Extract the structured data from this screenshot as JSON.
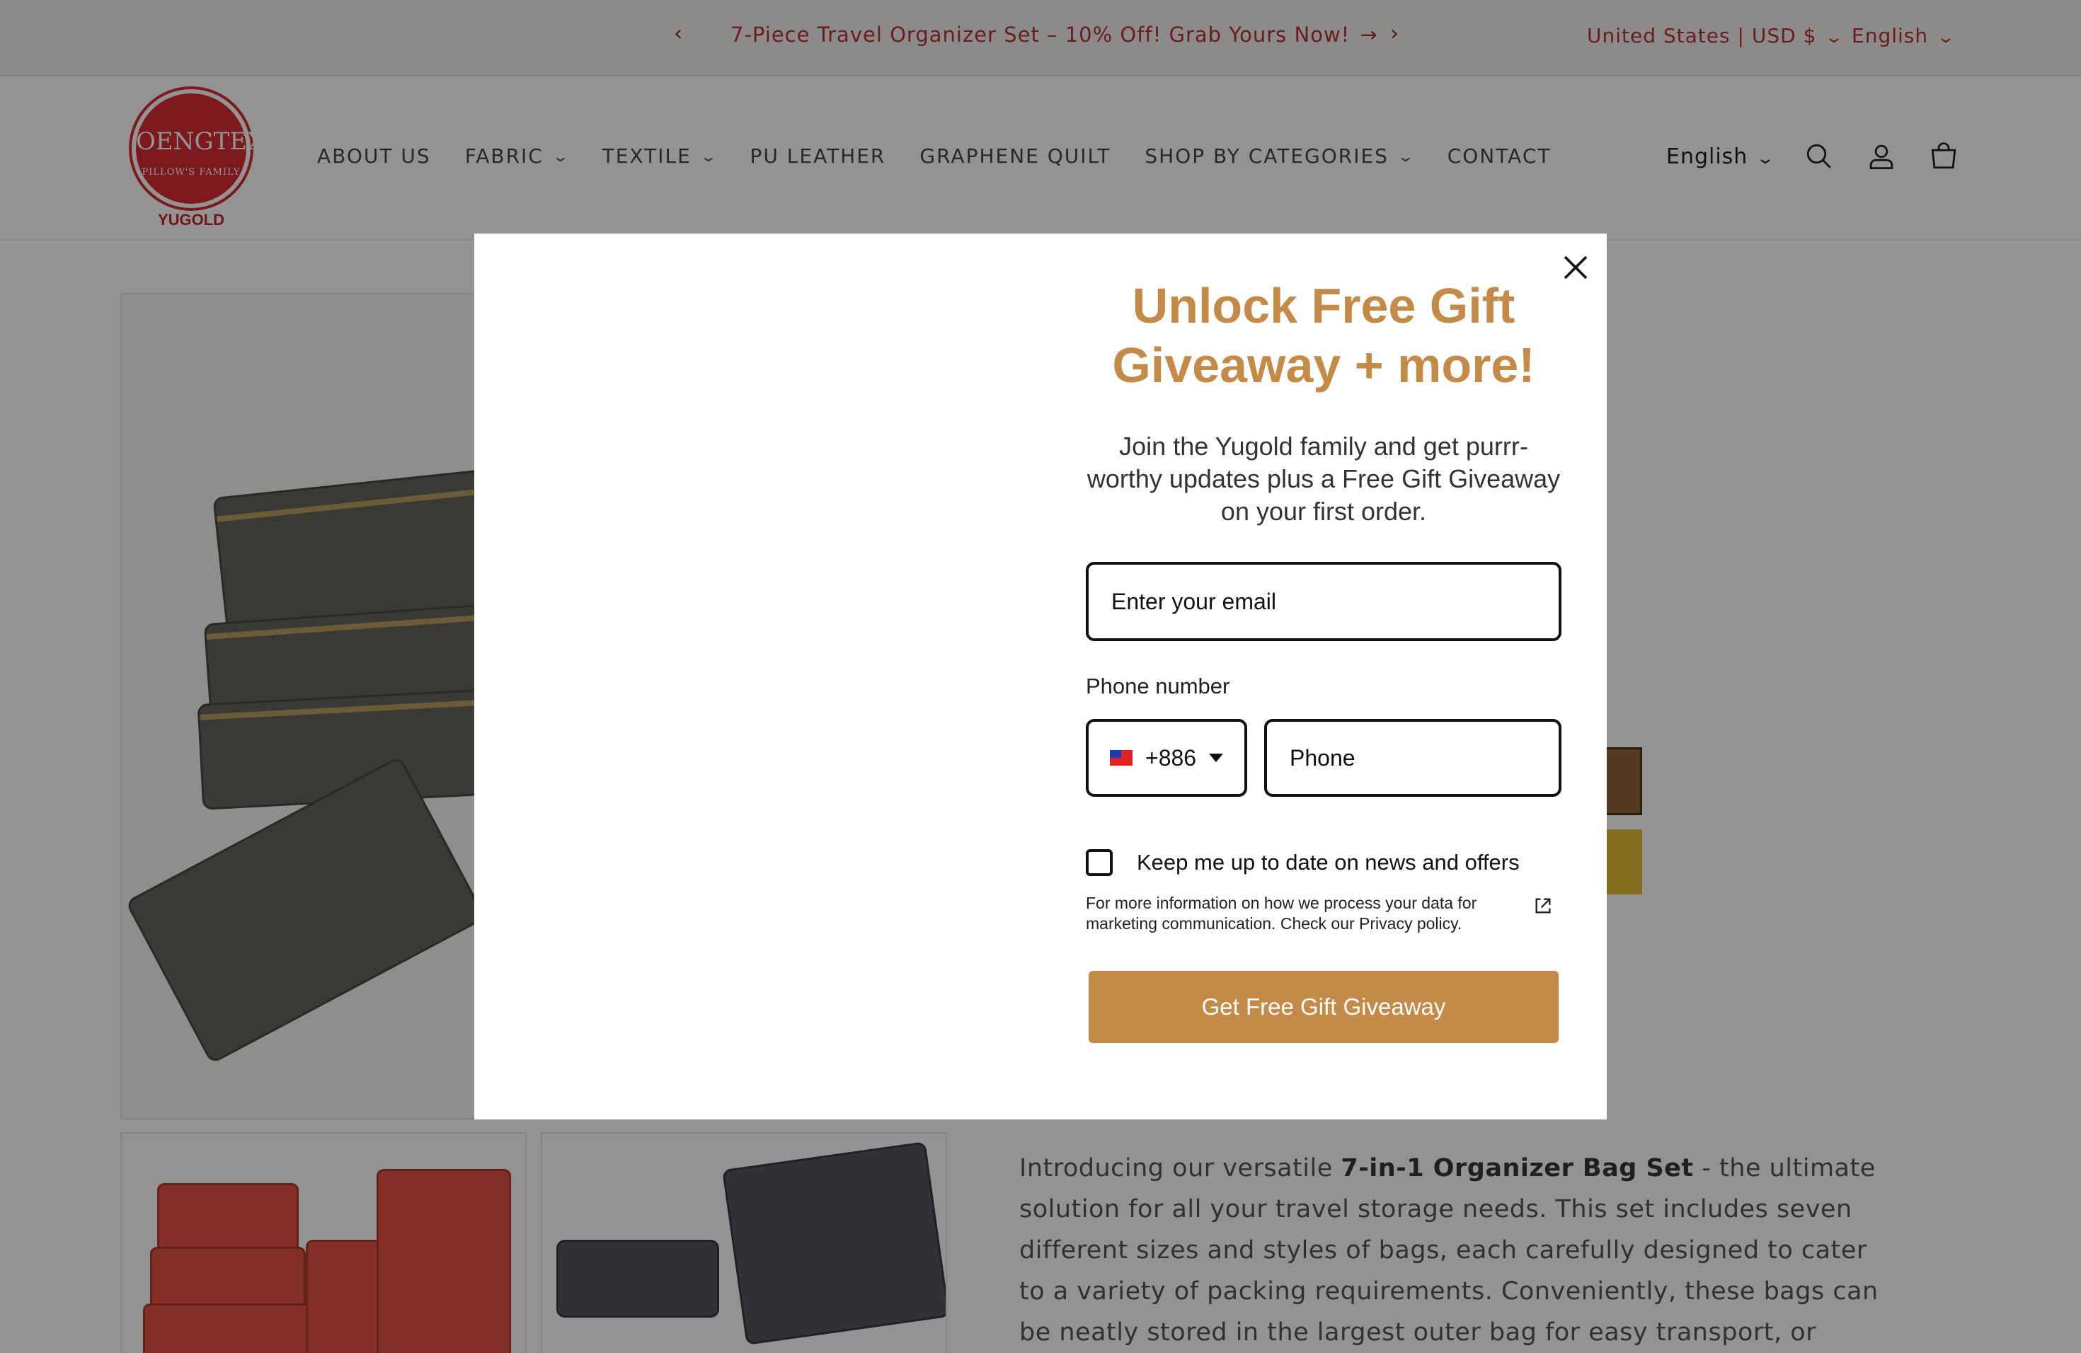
{
  "announcement": {
    "prev_icon": "chevron-left",
    "message": "7-Piece Travel Organizer Set – 10% Off! Grab Yours Now!",
    "message_icon": "arrow-right",
    "next_icon": "chevron-right",
    "locale": "United States | USD $",
    "language": "English"
  },
  "header": {
    "logo": {
      "mark": "OENGTEX",
      "tagline": "PILLOW'S FAMILY",
      "brand": "YUGOLD"
    },
    "nav": [
      {
        "label": "ABOUT US",
        "dropdown": false
      },
      {
        "label": "FABRIC",
        "dropdown": true
      },
      {
        "label": "TEXTILE",
        "dropdown": true
      },
      {
        "label": "PU LEATHER",
        "dropdown": false
      },
      {
        "label": "GRAPHENE QUILT",
        "dropdown": false
      },
      {
        "label": "SHOP BY CATEGORIES",
        "dropdown": true
      },
      {
        "label": "CONTACT",
        "dropdown": false
      }
    ],
    "language": "English",
    "icons": [
      "search-icon",
      "account-icon",
      "cart-icon"
    ]
  },
  "product": {
    "description_intro": "Introducing our versatile ",
    "description_bold": "7-in-1 Organizer Bag Set",
    "description_rest": " - the ultimate solution for all your travel storage needs. This set includes seven different sizes and styles of bags, each carefully designed to cater to a variety of packing requirements. Conveniently, these bags can be neatly stored in the largest outer bag for easy transport, or used"
  },
  "popup": {
    "title": "Unlock Free Gift Giveaway + more!",
    "body": "Join the Yugold family and get purrr-worthy updates plus a Free Gift Giveaway on your first order.",
    "email_placeholder": "Enter your email",
    "phone_label": "Phone number",
    "country_code": "+886",
    "phone_placeholder": "Phone",
    "consent_label": "Keep me up to date on news and offers",
    "consent_checked": false,
    "privacy_text": "For more information on how we process your data for marketing communication. Check our Privacy policy.",
    "cta_label": "Get Free Gift Giveaway"
  },
  "colors": {
    "accent": "#c38a48",
    "announcement_text": "#b3262b",
    "logo_red": "#d51f26"
  }
}
